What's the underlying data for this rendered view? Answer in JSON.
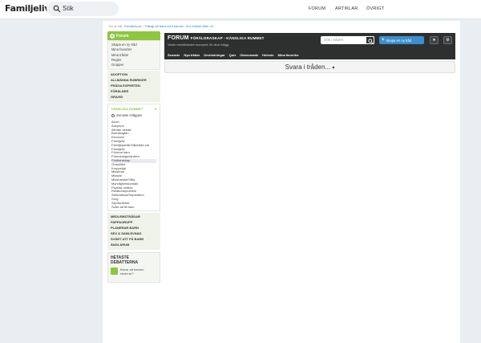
{
  "header": {
    "logo": "Familjeliv",
    "search_label": "Sök",
    "nav": [
      "FORUM",
      "ARTIKLAR",
      "ÖVRIGT"
    ]
  },
  "breadcrumb": {
    "prefix": "Du är här:",
    "items": [
      "Familjeliv.se",
      "Tråkigt att bära med barnen. Hur märket låter ni?"
    ]
  },
  "sidebar": {
    "forum_label": "Forum",
    "links": [
      "Skapa en ny tråd",
      "Mina favoriter",
      "Mina trådar",
      "Regler",
      "Grupper"
    ],
    "categories": [
      "ADOPTION",
      "ALLMÄNNA RUBRIKER",
      "FRÅGA EXPERTEN",
      "FÖRÄLDER",
      "GRAVID"
    ],
    "section": {
      "title": "KÄNSLIGA RUMMET",
      "latest": "Senaste inläggen",
      "items": [
        "Abort",
        "Adoption",
        "Allmän debatt",
        "Barnlängtan",
        "Ekonomi",
        "Familjeliv",
        "Familjejuridik/Våldrädd-val",
        "Familjeliv",
        "Förlorat barn",
        "Förmaningsvärdera",
        "Föräldraskap",
        "Graviditet",
        "Kroppsligt",
        "Missbruk",
        "Misstat",
        "Misshandel/Våld",
        "Myndighetskontakt",
        "Psykisk ohälsa",
        "Relationsproblem",
        "Skilsmässa/Separation",
        "Sorg",
        "Styvföräldrar",
        "Svårt att få barn"
      ],
      "active_index": 10
    },
    "categories_bottom": [
      "MEDLEMSTRÅDAR",
      "PAPPAGRUPP",
      "PLANERAR BARN",
      "SEX & SAMLEVNAD",
      "SVÅRT ATT FÅ BARN",
      "ÄNGLARUM"
    ],
    "hot": {
      "title_line1": "HETASTE",
      "title_line2": "DEBATTERNA",
      "question": "Klarar att barnen studerar?"
    }
  },
  "forum_header": {
    "title": "FORUM",
    "subtitle": "FÖRÄLDRASKAP - KÄNSLIGA RUMMET",
    "tagline": "Visste meddelanden anonymt, för dina inlägg.",
    "search_placeholder": "Sök i tråden",
    "new_thread_label": "Skapa en ny tråd",
    "tabs": [
      "Senaste",
      "Nya trådar",
      "Omröstningar",
      "Quiz",
      "Obesvarade",
      "Heteste",
      "Mina favoriter"
    ]
  },
  "reply_label": "Svara i tråden...",
  "colors": {
    "accent_green": "#8dc63f",
    "header_dark": "#2e3030",
    "button_blue": "#3b8fd0"
  }
}
